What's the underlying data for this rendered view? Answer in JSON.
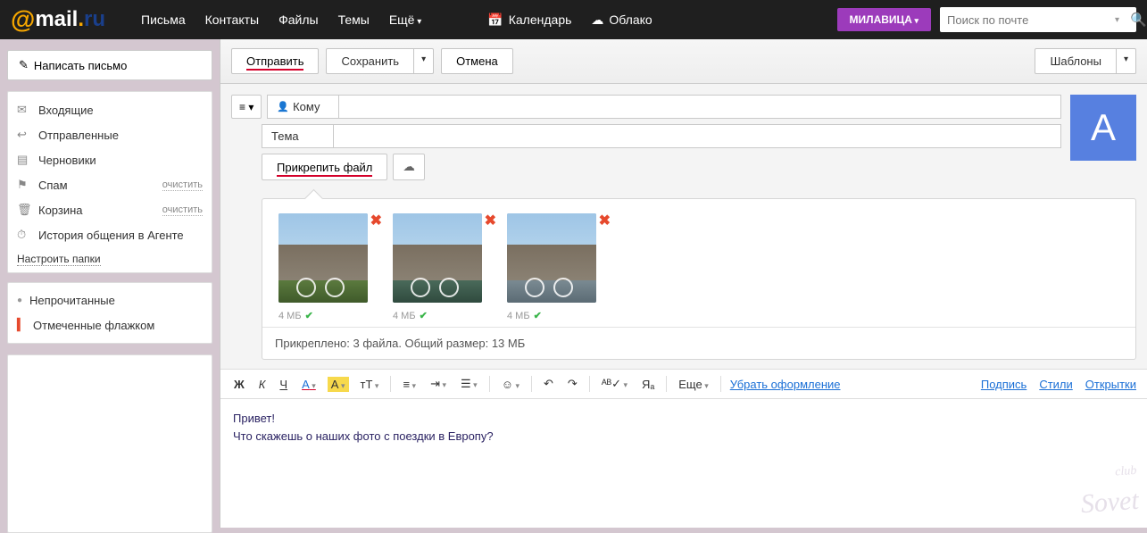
{
  "header": {
    "nav": [
      "Письма",
      "Контакты",
      "Файлы",
      "Темы",
      "Ещё"
    ],
    "calendar": "Календарь",
    "cloud": "Облако",
    "user": "МИЛАВИЦА",
    "search_placeholder": "Поиск по почте"
  },
  "sidebar": {
    "compose": "Написать письмо",
    "folders": [
      {
        "icon": "✉",
        "label": "Входящие"
      },
      {
        "icon": "↩",
        "label": "Отправленные"
      },
      {
        "icon": "▤",
        "label": "Черновики"
      },
      {
        "icon": "⚑",
        "label": "Спам",
        "action": "очистить"
      },
      {
        "icon": "🗑",
        "label": "Корзина",
        "action": "очистить"
      },
      {
        "icon": "⏱",
        "label": "История общения в Агенте"
      }
    ],
    "settings": "Настроить папки",
    "filters": [
      {
        "cls": "bullet-unread",
        "label": "Непрочитанные"
      },
      {
        "cls": "bullet-flag",
        "label": "Отмеченные флажком"
      }
    ]
  },
  "toolbar": {
    "send": "Отправить",
    "save": "Сохранить",
    "cancel": "Отмена",
    "templates": "Шаблоны"
  },
  "compose": {
    "to": "Кому",
    "subject": "Тема",
    "attach": "Прикрепить файл",
    "avatar": "А"
  },
  "attachments": {
    "items": [
      {
        "size": "4 МБ"
      },
      {
        "size": "4 МБ"
      },
      {
        "size": "4 МБ"
      }
    ],
    "summary": "Прикреплено: 3 файла. Общий размер: 13 МБ"
  },
  "editor": {
    "more": "Еще",
    "unstyle": "Убрать оформление",
    "links": [
      "Подпись",
      "Стили",
      "Открытки"
    ],
    "body_line1": "Привет!",
    "body_line2": "Что скажешь о наших фото с поездки в Европу?"
  },
  "watermark": {
    "top": "club",
    "bottom": "Sovet"
  }
}
